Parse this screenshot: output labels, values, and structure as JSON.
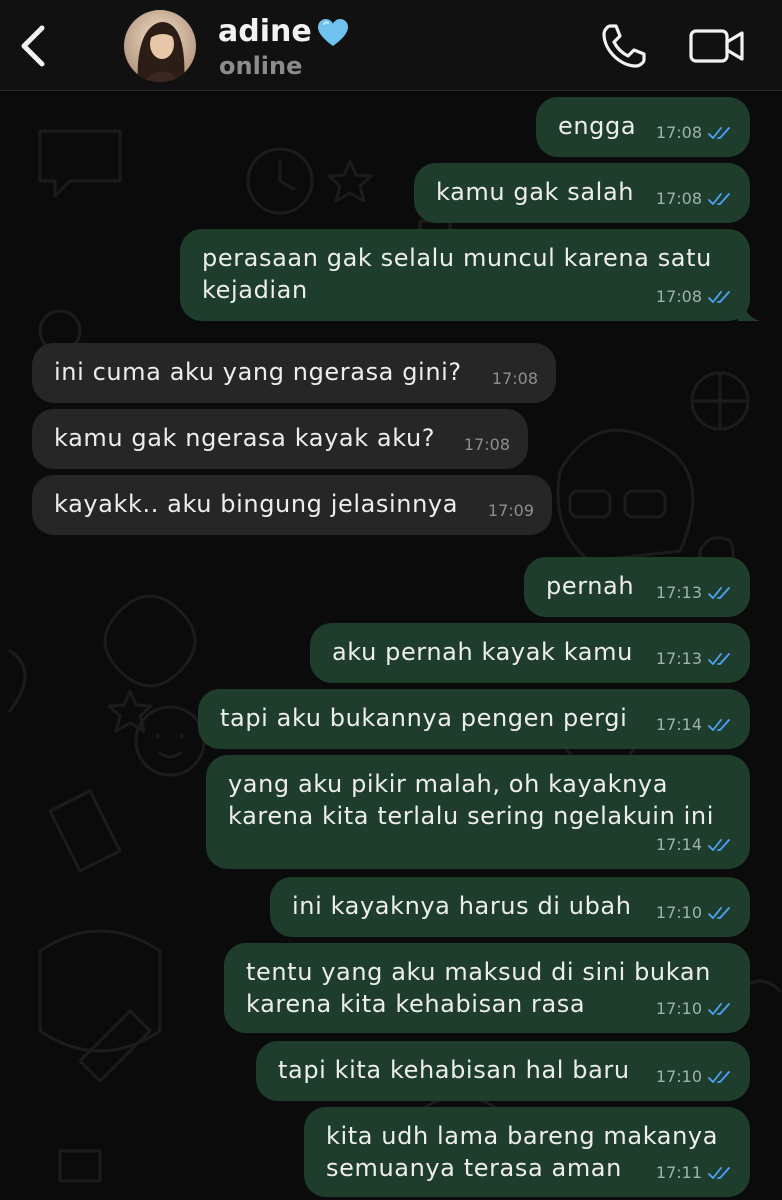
{
  "header": {
    "contact_name": "adine",
    "status": "online"
  },
  "colors": {
    "outgoing_bubble": "#1f3d2d",
    "incoming_bubble": "#262626",
    "read_tick": "#4fa3f7",
    "background": "#0b0b0b"
  },
  "icons": {
    "back": "chevron-left-icon",
    "heart": "blue-heart-icon",
    "call": "phone-icon",
    "video": "video-camera-icon",
    "read_status": "double-check-icon"
  },
  "messages": [
    {
      "direction": "out",
      "text": "engga",
      "time": "17:08",
      "read": true
    },
    {
      "direction": "out",
      "text": "kamu gak salah",
      "time": "17:08",
      "read": true
    },
    {
      "direction": "out",
      "text": "perasaan gak selalu muncul karena satu\nkejadian",
      "time": "17:08",
      "read": true
    },
    {
      "direction": "in",
      "text": "ini cuma aku yang ngerasa gini?",
      "time": "17:08"
    },
    {
      "direction": "in",
      "text": "kamu gak ngerasa kayak aku?",
      "time": "17:08"
    },
    {
      "direction": "in",
      "text": "kayakk.. aku bingung jelasinnya",
      "time": "17:09"
    },
    {
      "direction": "out",
      "text": "pernah",
      "time": "17:13",
      "read": true
    },
    {
      "direction": "out",
      "text": "aku pernah kayak kamu",
      "time": "17:13",
      "read": true
    },
    {
      "direction": "out",
      "text": "tapi aku bukannya pengen pergi",
      "time": "17:14",
      "read": true
    },
    {
      "direction": "out",
      "text": "yang aku pikir malah, oh kayaknya\nkarena kita terlalu sering ngelakuin ini",
      "time": "17:14",
      "read": true
    },
    {
      "direction": "out",
      "text": "ini kayaknya harus di ubah",
      "time": "17:10",
      "read": true
    },
    {
      "direction": "out",
      "text": "tentu yang aku maksud di sini bukan\nkarena kita kehabisan rasa",
      "time": "17:10",
      "read": true
    },
    {
      "direction": "out",
      "text": "tapi kita kehabisan hal baru",
      "time": "17:10",
      "read": true
    },
    {
      "direction": "out",
      "text": "kita udh lama bareng makanya\nsemuanya terasa aman",
      "time": "17:11",
      "read": true
    }
  ]
}
